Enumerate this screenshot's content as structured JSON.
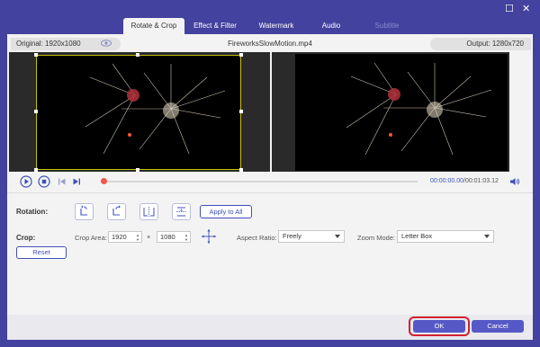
{
  "window": {
    "controls": [
      "☐",
      "✕"
    ]
  },
  "tabs": [
    {
      "label": "Rotate & Crop",
      "state": "active"
    },
    {
      "label": "Effect & Filter",
      "state": "normal"
    },
    {
      "label": "Watermark",
      "state": "normal"
    },
    {
      "label": "Audio",
      "state": "normal"
    },
    {
      "label": "Subtitle",
      "state": "disabled"
    }
  ],
  "info": {
    "original": "Original: 1920x1080",
    "filename": "FireworksSlowMotion.mp4",
    "output": "Output: 1280x720"
  },
  "playback": {
    "current_time": "00:00:00.00",
    "separator": "/",
    "total_time": "00:01:03.12",
    "progress": 0
  },
  "rotation": {
    "label": "Rotation:",
    "apply_all_label": "Apply to All",
    "buttons": [
      "rotate-left",
      "rotate-right",
      "flip-horizontal",
      "flip-vertical"
    ]
  },
  "crop": {
    "label": "Crop:",
    "area_label": "Crop Area:",
    "width": "1920",
    "times": "×",
    "height": "1080",
    "aspect_label": "Aspect Ratio:",
    "aspect_value": "Freely",
    "zoom_label": "Zoom Mode:",
    "zoom_value": "Letter Box",
    "reset_label": "Reset"
  },
  "footer": {
    "ok_label": "OK",
    "cancel_label": "Cancel"
  },
  "colors": {
    "accent": "#5658c6",
    "window_bg": "#43429e",
    "highlight": "#d2212f",
    "crop_frame": "#c7c000",
    "time_current": "#3d56c6"
  }
}
